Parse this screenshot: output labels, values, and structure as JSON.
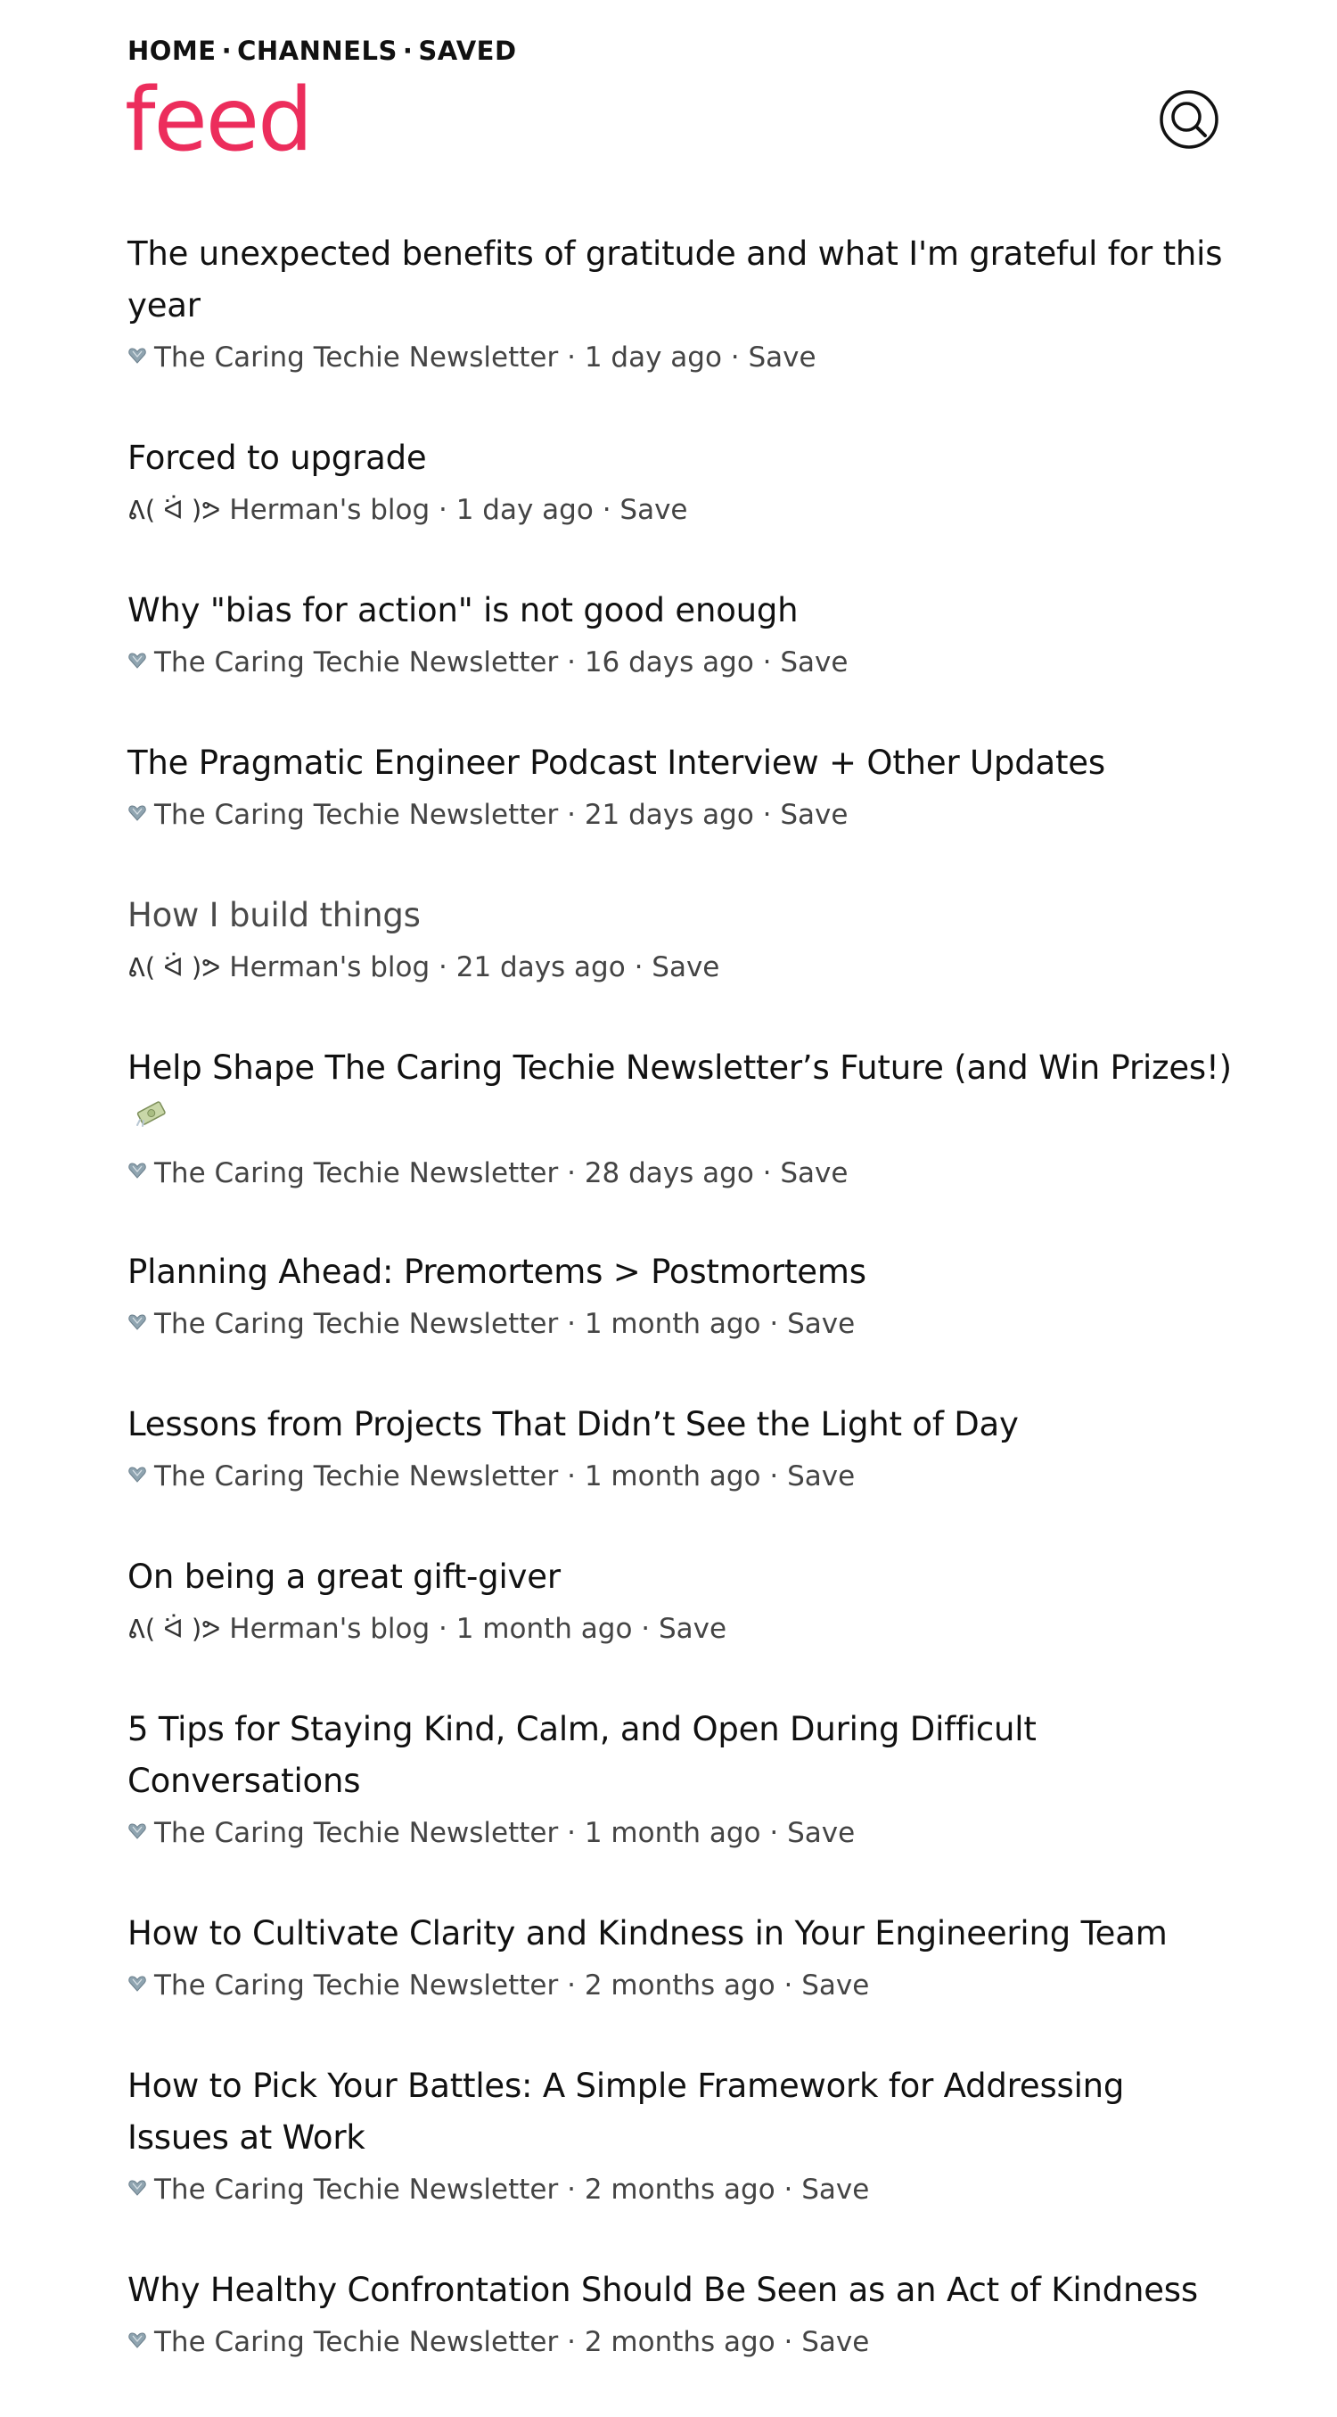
{
  "nav": {
    "home": "HOME",
    "channels": "CHANNELS",
    "saved": "SAVED",
    "separator": "·"
  },
  "brand": {
    "title": "feed",
    "color": "#ec2d5c"
  },
  "search": {
    "icon": "search-icon"
  },
  "feed": {
    "items": [
      {
        "title": "The unexpected benefits of gratitude and what I'm grateful for this year",
        "source": "The Caring Techie Newsletter",
        "source_icon": "heart-icon",
        "age": "1 day ago",
        "save": "Save",
        "sep": "·"
      },
      {
        "title": "Forced to upgrade",
        "source": "Herman's blog",
        "source_icon_text": "ᕕ( ᐛ )ᕗ",
        "age": "1 day ago",
        "save": "Save",
        "sep": "·"
      },
      {
        "title": "Why \"bias for action\" is not good enough",
        "source": "The Caring Techie Newsletter",
        "source_icon": "heart-icon",
        "age": "16 days ago",
        "save": "Save",
        "sep": "·"
      },
      {
        "title": "The Pragmatic Engineer Podcast Interview + Other Updates",
        "source": "The Caring Techie Newsletter",
        "source_icon": "heart-icon",
        "age": "21 days ago",
        "save": "Save",
        "sep": "·"
      },
      {
        "title": "How I build things",
        "source": "Herman's blog",
        "source_icon_text": "ᕕ( ᐛ )ᕗ",
        "age": "21 days ago",
        "save": "Save",
        "sep": "·"
      },
      {
        "title": "Help Shape The Caring Techie Newsletter’s Future (and Win Prizes!)",
        "source": "The Caring Techie Newsletter",
        "source_icon": "heart-icon",
        "age": "28 days ago",
        "save": "Save",
        "sep": "·"
      },
      {
        "title": "Planning Ahead: Premortems > Postmortems",
        "source": "The Caring Techie Newsletter",
        "source_icon": "heart-icon",
        "age": "1 month ago",
        "save": "Save",
        "sep": "·"
      },
      {
        "title": "Lessons from Projects That Didn’t See the Light of Day",
        "source": "The Caring Techie Newsletter",
        "source_icon": "heart-icon",
        "age": "1 month ago",
        "save": "Save",
        "sep": "·"
      },
      {
        "title": "On being a great gift-giver",
        "source": "Herman's blog",
        "source_icon_text": "ᕕ( ᐛ )ᕗ",
        "age": "1 month ago",
        "save": "Save",
        "sep": "·"
      },
      {
        "title": "5 Tips for Staying Kind, Calm, and Open During Difficult Conversations",
        "source": "The Caring Techie Newsletter",
        "source_icon": "heart-icon",
        "age": "1 month ago",
        "save": "Save",
        "sep": "·"
      },
      {
        "title": "How to Cultivate Clarity and Kindness in Your Engineering Team",
        "source": "The Caring Techie Newsletter",
        "source_icon": "heart-icon",
        "age": "2 months ago",
        "save": "Save",
        "sep": "·"
      },
      {
        "title": "How to Pick Your Battles: A Simple Framework for Addressing Issues at Work",
        "source": "The Caring Techie Newsletter",
        "source_icon": "heart-icon",
        "age": "2 months ago",
        "save": "Save",
        "sep": "·"
      },
      {
        "title": "Why Healthy Confrontation Should Be Seen as an Act of Kindness",
        "source": "The Caring Techie Newsletter",
        "source_icon": "heart-icon",
        "age": "2 months ago",
        "save": "Save",
        "sep": "·"
      }
    ]
  }
}
